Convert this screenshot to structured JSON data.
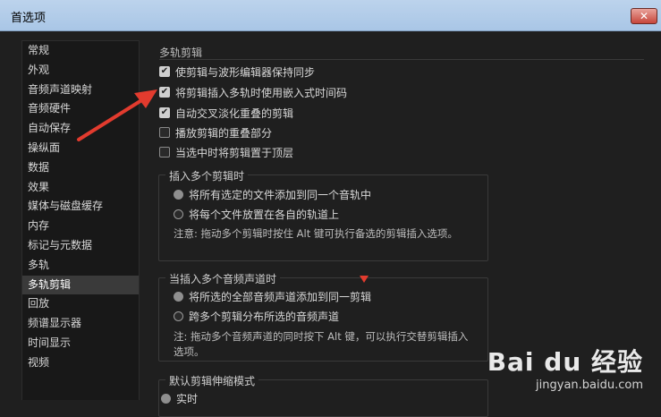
{
  "window": {
    "title": "首选项",
    "close_label": "✕"
  },
  "sidebar": {
    "items": [
      {
        "label": "常规"
      },
      {
        "label": "外观"
      },
      {
        "label": "音频声道映射"
      },
      {
        "label": "音频硬件"
      },
      {
        "label": "自动保存"
      },
      {
        "label": "操纵面"
      },
      {
        "label": "数据"
      },
      {
        "label": "效果"
      },
      {
        "label": "媒体与磁盘缓存"
      },
      {
        "label": "内存"
      },
      {
        "label": "标记与元数据"
      },
      {
        "label": "多轨"
      },
      {
        "label": "多轨剪辑"
      },
      {
        "label": "回放"
      },
      {
        "label": "频谱显示器"
      },
      {
        "label": "时间显示"
      },
      {
        "label": "视频"
      }
    ],
    "active": "多轨剪辑"
  },
  "main": {
    "section_title": "多轨剪辑",
    "checkboxes": [
      {
        "label": "使剪辑与波形编辑器保持同步",
        "checked": true
      },
      {
        "label": "将剪辑插入多轨时使用嵌入式时间码",
        "checked": true
      },
      {
        "label": "自动交叉淡化重叠的剪辑",
        "checked": true
      },
      {
        "label": "播放剪辑的重叠部分",
        "checked": false
      },
      {
        "label": "当选中时将剪辑置于顶层",
        "checked": false
      }
    ],
    "group1": {
      "title": "插入多个剪辑时",
      "options": [
        {
          "label": "将所有选定的文件添加到同一个音轨中",
          "selected": true
        },
        {
          "label": "将每个文件放置在各自的轨道上",
          "selected": false
        }
      ],
      "note": "注意: 拖动多个剪辑时按住 Alt 键可执行备选的剪辑插入选项。"
    },
    "group2": {
      "title": "当插入多个音频声道时",
      "options": [
        {
          "label": "将所选的全部音频声道添加到同一剪辑",
          "selected": true
        },
        {
          "label": "跨多个剪辑分布所选的音频声道",
          "selected": false
        }
      ],
      "note_line1": "注: 拖动多个音频声道的同时按下 Alt 键，可以执行交替剪辑插入",
      "note_line2": "选项。"
    },
    "group3": {
      "title": "默认剪辑伸缩模式",
      "options": [
        {
          "label": "实时",
          "selected": true
        }
      ]
    }
  },
  "watermark": {
    "text": "Bai du 经验",
    "url": "jingyan.baidu.com"
  },
  "colors": {
    "annotation": "#e23b2e"
  }
}
